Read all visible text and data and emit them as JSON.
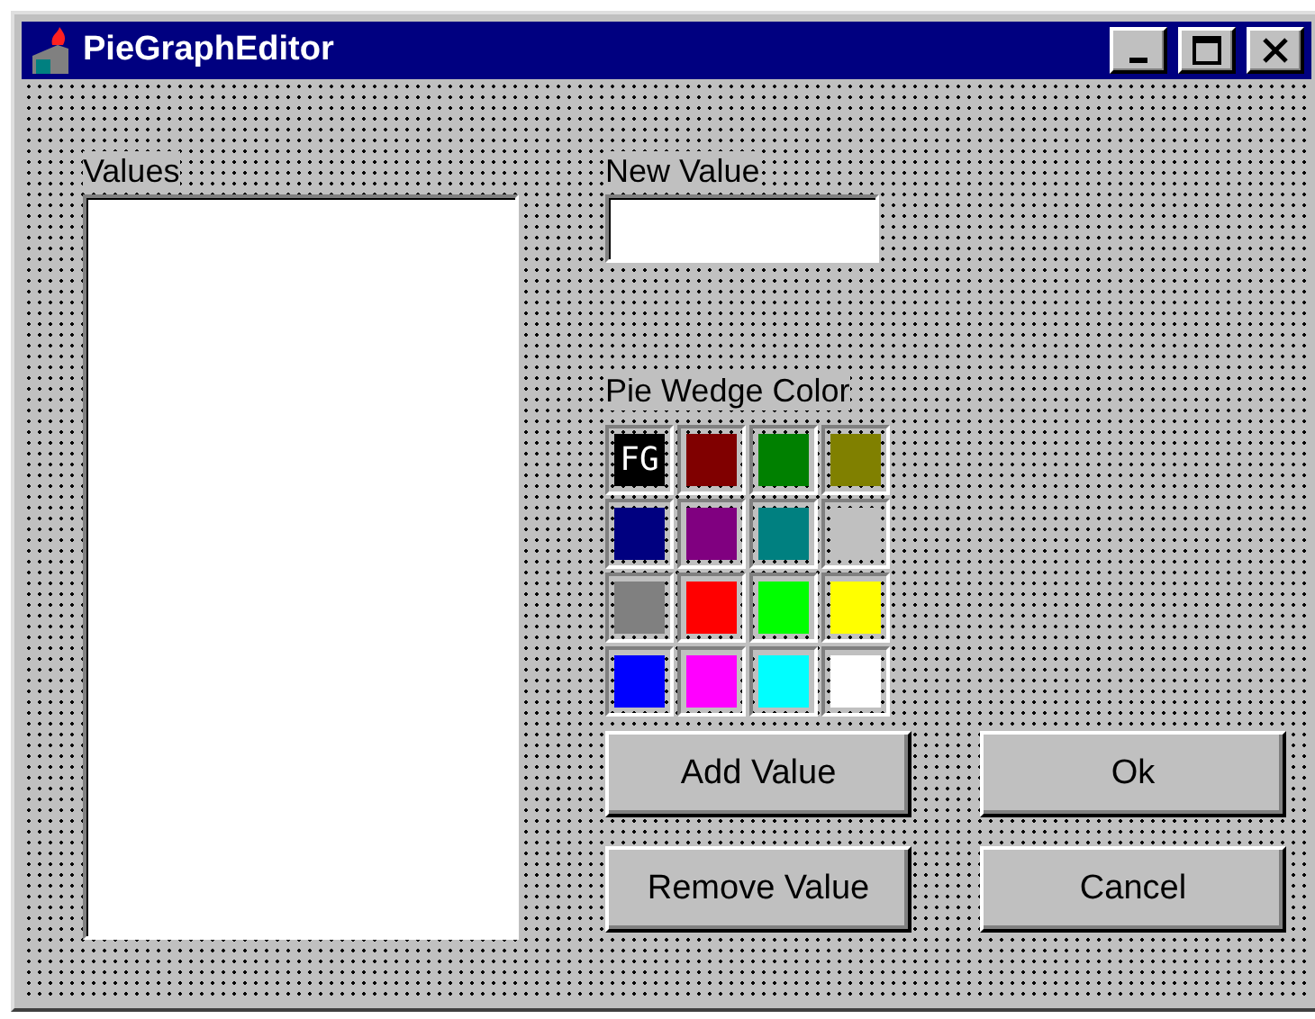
{
  "window": {
    "title": "PieGraphEditor"
  },
  "values_list": {
    "label": "Values"
  },
  "new_value": {
    "label": "New Value"
  },
  "pie_wedge_color": {
    "label": "Pie Wedge Color",
    "swatches": [
      {
        "color": "#000000",
        "label": "FG"
      },
      {
        "color": "#800000"
      },
      {
        "color": "#008000"
      },
      {
        "color": "#808000"
      },
      {
        "color": "#000080"
      },
      {
        "color": "#800080"
      },
      {
        "color": "#008080"
      },
      {
        "color": "#c0c0c0"
      },
      {
        "color": "#808080"
      },
      {
        "color": "#ff0000"
      },
      {
        "color": "#00ff00"
      },
      {
        "color": "#ffff00"
      },
      {
        "color": "#0000ff"
      },
      {
        "color": "#ff00ff"
      },
      {
        "color": "#00ffff"
      },
      {
        "color": "#ffffff"
      }
    ]
  },
  "buttons": [
    {
      "label": "Add Value"
    },
    {
      "label": "Ok"
    },
    {
      "label": "Remove Value"
    },
    {
      "label": "Cancel"
    }
  ]
}
